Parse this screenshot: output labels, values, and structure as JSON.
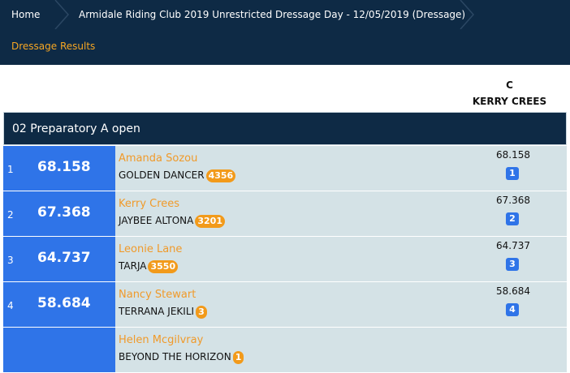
{
  "breadcrumb": {
    "home": "Home",
    "event": "Armidale Riding Club 2019 Unrestricted Dressage Day - 12/05/2019 (Dressage)"
  },
  "subnav": {
    "results_link": "Dressage Results"
  },
  "judge": {
    "position": "C",
    "name": "KERRY CREES"
  },
  "class": {
    "title": "02 Preparatory A open"
  },
  "results": [
    {
      "place": "1",
      "score": "68.158",
      "rider": "Amanda Sozou",
      "horse": "GOLDEN DANCER",
      "horse_badge": "4356",
      "judge_score": "68.158",
      "judge_place": "1"
    },
    {
      "place": "2",
      "score": "67.368",
      "rider": "Kerry Crees",
      "horse": "JAYBEE ALTONA",
      "horse_badge": "3201",
      "judge_score": "67.368",
      "judge_place": "2"
    },
    {
      "place": "3",
      "score": "64.737",
      "rider": "Leonie Lane",
      "horse": "TARJA",
      "horse_badge": "3550",
      "judge_score": "64.737",
      "judge_place": "3"
    },
    {
      "place": "4",
      "score": "58.684",
      "rider": "Nancy Stewart",
      "horse": "TERRANA JEKILI",
      "horse_badge": "3",
      "judge_score": "58.684",
      "judge_place": "4"
    },
    {
      "place": "",
      "score": "",
      "rider": "Helen Mcgilvray",
      "horse": "BEYOND THE HORIZON",
      "horse_badge": "1",
      "judge_score": "",
      "judge_place": ""
    }
  ],
  "colors": {
    "header_bg": "#0e2a45",
    "accent_orange": "#f5a623",
    "rank_blue": "#2f74e8",
    "row_bg": "#d4e2e6"
  }
}
